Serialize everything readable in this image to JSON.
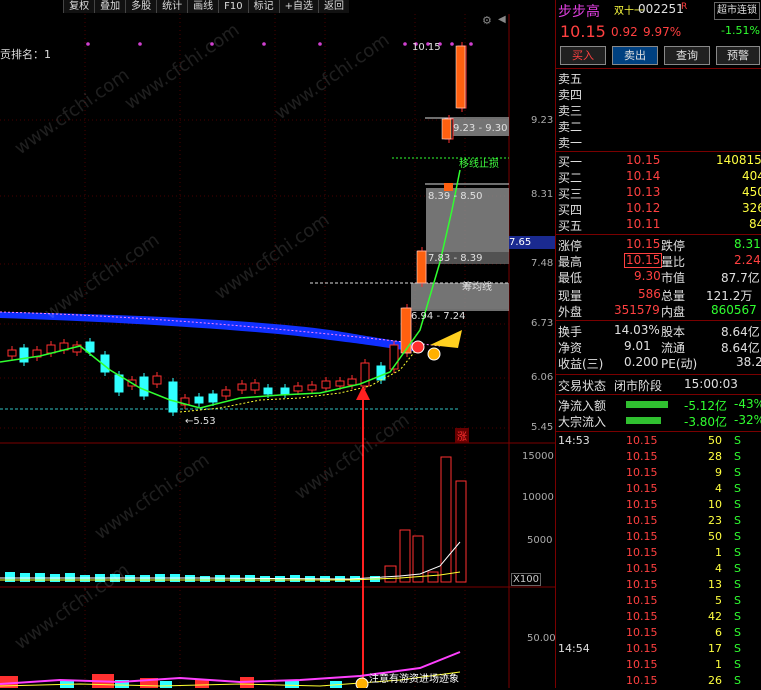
{
  "toolbar": {
    "items": [
      "复权",
      "叠加",
      "多股",
      "统计",
      "画线",
      "F10",
      "标记",
      "+自选",
      "返回"
    ]
  },
  "chart": {
    "indicator_label": "贡排名：1",
    "price_axis": [
      "9.23",
      "8.31",
      "7.65",
      "7.48",
      "6.73",
      "6.06",
      "5.45"
    ],
    "current_price_marker": "7.65",
    "top_label": "10.15",
    "low_label": "←5.53",
    "zones": [
      {
        "label": "9.23 - 9.30"
      },
      {
        "label": "8.39 - 8.50"
      },
      {
        "label": "7.83 - 8.39"
      },
      {
        "label": "筹均线"
      },
      {
        "label": "6.94 - 7.24"
      }
    ],
    "stop_line_label": "移线止损",
    "rise_label": "涨",
    "volume_axis": [
      "15000",
      "10000",
      "5000"
    ],
    "volume_unit": "X100",
    "lower_axis": "50.00",
    "lower_annotation": "注意有游资进场迹象",
    "watermark": "www.cfchi.com"
  },
  "quote": {
    "name": "步步高",
    "tag": "双十一",
    "code": "002251",
    "code_suffix": "R",
    "sector": "超市连锁",
    "price": "10.15",
    "change": "0.92",
    "change_pct": "9.97%",
    "sector_change": "-1.51%",
    "buttons": [
      "买入",
      "卖出",
      "查询",
      "预警"
    ],
    "asks": [
      {
        "label": "卖五",
        "price": "",
        "vol": ""
      },
      {
        "label": "卖四",
        "price": "",
        "vol": ""
      },
      {
        "label": "卖三",
        "price": "",
        "vol": ""
      },
      {
        "label": "卖二",
        "price": "",
        "vol": ""
      },
      {
        "label": "卖一",
        "price": "",
        "vol": ""
      }
    ],
    "bids": [
      {
        "label": "买一",
        "price": "10.15",
        "vol": "140815"
      },
      {
        "label": "买二",
        "price": "10.14",
        "vol": "404"
      },
      {
        "label": "买三",
        "price": "10.13",
        "vol": "450"
      },
      {
        "label": "买四",
        "price": "10.12",
        "vol": "326"
      },
      {
        "label": "买五",
        "price": "10.11",
        "vol": "84"
      }
    ],
    "stats": [
      {
        "l1": "涨停",
        "v1": "10.15",
        "l2": "跌停",
        "v2": "8.31",
        "c1": "red",
        "c2": "grn"
      },
      {
        "l1": "最高",
        "v1": "10.15",
        "l2": "量比",
        "v2": "2.24",
        "c1": "red",
        "c2": "red"
      },
      {
        "l1": "最低",
        "v1": "9.30",
        "l2": "市值",
        "v2": "87.7亿",
        "c1": "red",
        "c2": "wht"
      },
      {
        "l1": "现量",
        "v1": "586",
        "l2": "总量",
        "v2": "121.2万",
        "c1": "red",
        "c2": "wht"
      },
      {
        "l1": "外盘",
        "v1": "351579",
        "l2": "内盘",
        "v2": "860567",
        "c1": "red",
        "c2": "grn"
      }
    ],
    "stats2": [
      {
        "l1": "换手",
        "v1": "14.03%",
        "l2": "股本",
        "v2": "8.64亿"
      },
      {
        "l1": "净资",
        "v1": "9.01",
        "l2": "流通",
        "v2": "8.64亿"
      },
      {
        "l1": "收益(三)",
        "v1": "0.200",
        "l2": "PE(动)",
        "v2": "38.2"
      }
    ],
    "trade_status_label": "交易状态",
    "trade_status": "闭市阶段",
    "trade_time": "15:00:03",
    "flows": [
      {
        "label": "净流入额",
        "value": "-5.12亿",
        "pct": "-43%"
      },
      {
        "label": "大宗流入",
        "value": "-3.80亿",
        "pct": "-32%"
      }
    ],
    "ticks": [
      {
        "time": "14:53",
        "price": "10.15",
        "vol": "50",
        "side": "S"
      },
      {
        "time": "",
        "price": "10.15",
        "vol": "28",
        "side": "S"
      },
      {
        "time": "",
        "price": "10.15",
        "vol": "9",
        "side": "S"
      },
      {
        "time": "",
        "price": "10.15",
        "vol": "4",
        "side": "S"
      },
      {
        "time": "",
        "price": "10.15",
        "vol": "10",
        "side": "S"
      },
      {
        "time": "",
        "price": "10.15",
        "vol": "23",
        "side": "S"
      },
      {
        "time": "",
        "price": "10.15",
        "vol": "50",
        "side": "S"
      },
      {
        "time": "",
        "price": "10.15",
        "vol": "1",
        "side": "S"
      },
      {
        "time": "",
        "price": "10.15",
        "vol": "4",
        "side": "S"
      },
      {
        "time": "",
        "price": "10.15",
        "vol": "13",
        "side": "S"
      },
      {
        "time": "",
        "price": "10.15",
        "vol": "5",
        "side": "S"
      },
      {
        "time": "",
        "price": "10.15",
        "vol": "42",
        "side": "S"
      },
      {
        "time": "",
        "price": "10.15",
        "vol": "6",
        "side": "S"
      },
      {
        "time": "14:54",
        "price": "10.15",
        "vol": "17",
        "side": "S"
      },
      {
        "time": "",
        "price": "10.15",
        "vol": "1",
        "side": "S"
      },
      {
        "time": "",
        "price": "10.15",
        "vol": "26",
        "side": "S"
      }
    ]
  },
  "colors": {
    "up": "#ff3030",
    "down": "#30ffff",
    "accent": "#7a0000"
  }
}
